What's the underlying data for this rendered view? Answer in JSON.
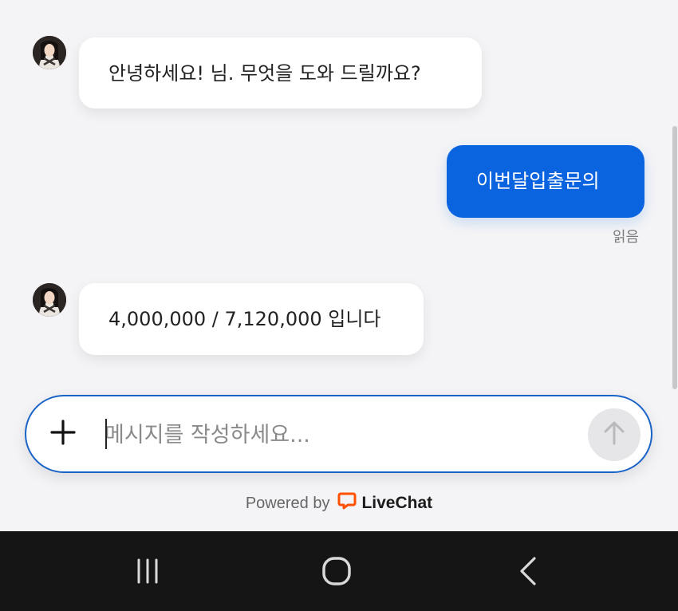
{
  "messages": [
    {
      "sender": "agent",
      "text": "안녕하세요! 님. 무엇을 도와 드릴까요?"
    },
    {
      "sender": "visitor",
      "text": "이번달입출문의",
      "status": "읽음"
    },
    {
      "sender": "agent",
      "text": "4,000,000 / 7,120,000 입니다"
    }
  ],
  "composer": {
    "placeholder": "메시지를 작성하세요...",
    "value": ""
  },
  "footer": {
    "powered_by": "Powered by",
    "brand": "LiveChat"
  },
  "colors": {
    "visitor_bubble": "#0a64e0",
    "composer_border": "#1a63c7",
    "brand_accent": "#ff5100"
  },
  "icons": {
    "add": "plus-icon",
    "send": "arrow-up-icon",
    "nav_recents": "recents-icon",
    "nav_home": "home-icon",
    "nav_back": "back-icon"
  }
}
